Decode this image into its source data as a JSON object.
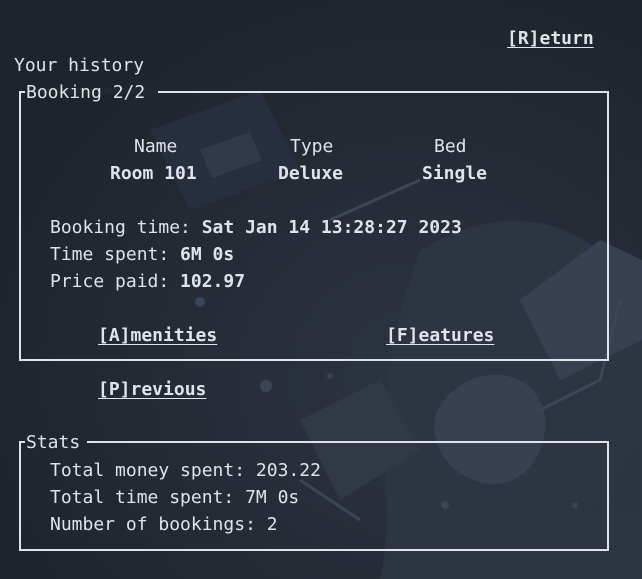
{
  "app": {
    "return_label": "[R]eturn",
    "heading": "Your history"
  },
  "booking": {
    "legend": "Booking 2/2",
    "headers": [
      "Name",
      "Type",
      "Bed"
    ],
    "values": [
      "Room 101",
      "Deluxe",
      "Single"
    ],
    "details": [
      {
        "label": "Booking time: ",
        "value": "Sat Jan 14 13:28:27 2023"
      },
      {
        "label": "Time spent: ",
        "value": "6M 0s"
      },
      {
        "label": "Price paid: ",
        "value": "102.97"
      }
    ],
    "amenities_label": "[A]menities",
    "features_label": "[F]eatures"
  },
  "nav": {
    "previous_label": "[P]revious"
  },
  "stats": {
    "legend": "Stats",
    "lines": [
      "Total money spent: 203.22",
      "Total time spent: 7M 0s",
      "Number of bookings: 2"
    ]
  },
  "colors": {
    "background": "#22272f",
    "text": "#dfe3ea"
  }
}
